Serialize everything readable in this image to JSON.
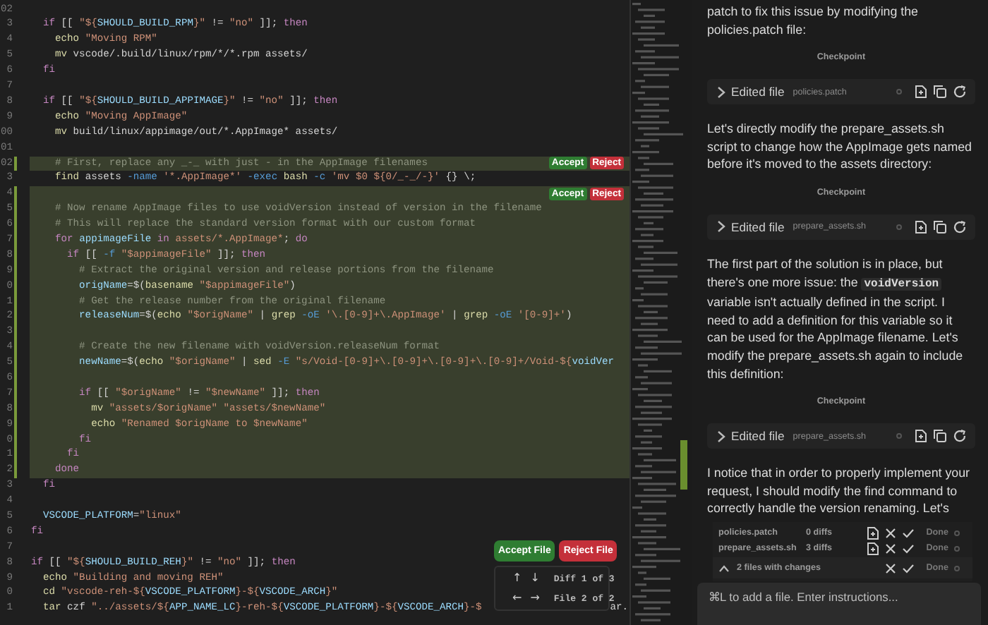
{
  "editor": {
    "lines": [
      {
        "number": "02",
        "added": false
      },
      {
        "number": "3",
        "added": false,
        "tokens": [
          {
            "kind": "kw",
            "text": "  if"
          },
          {
            "kind": "plain",
            "text": " [[ "
          },
          {
            "kind": "str",
            "text": "\"${"
          },
          {
            "kind": "var",
            "text": "SHOULD_BUILD_RPM"
          },
          {
            "kind": "str",
            "text": "}\""
          },
          {
            "kind": "plain",
            "text": " != "
          },
          {
            "kind": "str",
            "text": "\"no\""
          },
          {
            "kind": "plain",
            "text": " ]]; "
          },
          {
            "kind": "kw",
            "text": "then"
          }
        ]
      },
      {
        "number": "4",
        "added": false,
        "tokens": [
          {
            "kind": "cmd",
            "text": "    echo"
          },
          {
            "kind": "str",
            "text": " \"Moving RPM\""
          }
        ]
      },
      {
        "number": "5",
        "added": false,
        "tokens": [
          {
            "kind": "cmd",
            "text": "    mv"
          },
          {
            "kind": "plain",
            "text": " vscode/.build/linux/rpm/*/*.rpm assets/"
          }
        ]
      },
      {
        "number": "6",
        "added": false,
        "tokens": [
          {
            "kind": "kw",
            "text": "  fi"
          }
        ]
      },
      {
        "number": "7",
        "added": false
      },
      {
        "number": "8",
        "added": false,
        "tokens": [
          {
            "kind": "kw",
            "text": "  if"
          },
          {
            "kind": "plain",
            "text": " [[ "
          },
          {
            "kind": "str",
            "text": "\"${"
          },
          {
            "kind": "var",
            "text": "SHOULD_BUILD_APPIMAGE"
          },
          {
            "kind": "str",
            "text": "}\""
          },
          {
            "kind": "plain",
            "text": " != "
          },
          {
            "kind": "str",
            "text": "\"no\""
          },
          {
            "kind": "plain",
            "text": " ]]; "
          },
          {
            "kind": "kw",
            "text": "then"
          }
        ]
      },
      {
        "number": "9",
        "added": false,
        "tokens": [
          {
            "kind": "cmd",
            "text": "    echo"
          },
          {
            "kind": "str",
            "text": " \"Moving AppImage\""
          }
        ]
      },
      {
        "number": "00",
        "added": false,
        "tokens": [
          {
            "kind": "cmd",
            "text": "    mv"
          },
          {
            "kind": "plain",
            "text": " build/linux/appimage/out/*.AppImage* assets/"
          }
        ]
      },
      {
        "number": "01",
        "added": false
      },
      {
        "number": "02",
        "added": true,
        "tokens": [
          {
            "kind": "cmt",
            "text": "    # First, replace any _-_ with just - in the AppImage filenames"
          }
        ],
        "actions": [
          {
            "label": "Accept",
            "kind": "accept"
          },
          {
            "label": "Reject",
            "kind": "reject"
          }
        ]
      },
      {
        "number": "3",
        "added": false,
        "tokens": [
          {
            "kind": "cmd",
            "text": "    find"
          },
          {
            "kind": "plain",
            "text": " assets "
          },
          {
            "kind": "flag",
            "text": "-name"
          },
          {
            "kind": "str",
            "text": " '*.AppImage*'"
          },
          {
            "kind": "flag",
            "text": " -exec"
          },
          {
            "kind": "cmd",
            "text": " bash"
          },
          {
            "kind": "flag",
            "text": " -c"
          },
          {
            "kind": "str",
            "text": " 'mv $0 ${0/_-_/-}'"
          },
          {
            "kind": "plain",
            "text": " {} \\;"
          }
        ]
      },
      {
        "number": "4",
        "added": true,
        "actions": [
          {
            "label": "Accept",
            "kind": "accept"
          },
          {
            "label": "Reject",
            "kind": "reject"
          }
        ]
      },
      {
        "number": "5",
        "added": true,
        "tokens": [
          {
            "kind": "cmt",
            "text": "    # Now rename AppImage files to use voidVersion instead of version in the filename"
          }
        ]
      },
      {
        "number": "6",
        "added": true,
        "tokens": [
          {
            "kind": "cmt",
            "text": "    # This will replace the standard version format with our custom format"
          }
        ]
      },
      {
        "number": "7",
        "added": true,
        "tokens": [
          {
            "kind": "kw",
            "text": "    for"
          },
          {
            "kind": "var",
            "text": " appimageFile"
          },
          {
            "kind": "kw",
            "text": " in"
          },
          {
            "kind": "str",
            "text": " assets/*.AppImage*"
          },
          {
            "kind": "plain",
            "text": "; "
          },
          {
            "kind": "kw",
            "text": "do"
          }
        ]
      },
      {
        "number": "8",
        "added": true,
        "tokens": [
          {
            "kind": "kw",
            "text": "      if"
          },
          {
            "kind": "plain",
            "text": " [[ "
          },
          {
            "kind": "flag",
            "text": "-f"
          },
          {
            "kind": "str",
            "text": " \"$appimageFile\""
          },
          {
            "kind": "plain",
            "text": " ]]; "
          },
          {
            "kind": "kw",
            "text": "then"
          }
        ]
      },
      {
        "number": "9",
        "added": true,
        "tokens": [
          {
            "kind": "cmt",
            "text": "        # Extract the original version and release portions from the filename"
          }
        ]
      },
      {
        "number": "0",
        "added": true,
        "tokens": [
          {
            "kind": "var",
            "text": "        origName"
          },
          {
            "kind": "plain",
            "text": "=$("
          },
          {
            "kind": "cmd",
            "text": "basename"
          },
          {
            "kind": "str",
            "text": " \"$appimageFile\""
          },
          {
            "kind": "plain",
            "text": ")"
          }
        ]
      },
      {
        "number": "1",
        "added": true,
        "tokens": [
          {
            "kind": "cmt",
            "text": "        # Get the release number from the original filename"
          }
        ]
      },
      {
        "number": "2",
        "added": true,
        "tokens": [
          {
            "kind": "var",
            "text": "        releaseNum"
          },
          {
            "kind": "plain",
            "text": "=$("
          },
          {
            "kind": "cmd",
            "text": "echo"
          },
          {
            "kind": "str",
            "text": " \"$origName\""
          },
          {
            "kind": "plain",
            "text": " | "
          },
          {
            "kind": "cmd",
            "text": "grep"
          },
          {
            "kind": "flag",
            "text": " -oE"
          },
          {
            "kind": "str",
            "text": " '\\.[0-9]+\\.AppImage'"
          },
          {
            "kind": "plain",
            "text": " | "
          },
          {
            "kind": "cmd",
            "text": "grep"
          },
          {
            "kind": "flag",
            "text": " -oE"
          },
          {
            "kind": "str",
            "text": " '[0-9]+'"
          },
          {
            "kind": "plain",
            "text": ")"
          }
        ]
      },
      {
        "number": "3",
        "added": true
      },
      {
        "number": "4",
        "added": true,
        "tokens": [
          {
            "kind": "cmt",
            "text": "        # Create the new filename with voidVersion.releaseNum format"
          }
        ]
      },
      {
        "number": "5",
        "added": true,
        "tokens": [
          {
            "kind": "var",
            "text": "        newName"
          },
          {
            "kind": "plain",
            "text": "=$("
          },
          {
            "kind": "cmd",
            "text": "echo"
          },
          {
            "kind": "str",
            "text": " \"$origName\""
          },
          {
            "kind": "plain",
            "text": " | "
          },
          {
            "kind": "cmd",
            "text": "sed"
          },
          {
            "kind": "flag",
            "text": " -E"
          },
          {
            "kind": "str",
            "text": " \"s/Void-[0-9]+\\.[0-9]+\\.[0-9]+\\.[0-9]+/Void-${"
          },
          {
            "kind": "var",
            "text": "voidVer"
          }
        ]
      },
      {
        "number": "6",
        "added": true
      },
      {
        "number": "7",
        "added": true,
        "tokens": [
          {
            "kind": "kw",
            "text": "        if"
          },
          {
            "kind": "plain",
            "text": " [[ "
          },
          {
            "kind": "str",
            "text": "\"$origName\""
          },
          {
            "kind": "plain",
            "text": " != "
          },
          {
            "kind": "str",
            "text": "\"$newName\""
          },
          {
            "kind": "plain",
            "text": " ]]; "
          },
          {
            "kind": "kw",
            "text": "then"
          }
        ]
      },
      {
        "number": "8",
        "added": true,
        "tokens": [
          {
            "kind": "cmd",
            "text": "          mv"
          },
          {
            "kind": "str",
            "text": " \"assets/$origName\" \"assets/$newName\""
          }
        ]
      },
      {
        "number": "9",
        "added": true,
        "tokens": [
          {
            "kind": "cmd",
            "text": "          echo"
          },
          {
            "kind": "str",
            "text": " \"Renamed $origName to $newName\""
          }
        ]
      },
      {
        "number": "0",
        "added": true,
        "tokens": [
          {
            "kind": "kw",
            "text": "        fi"
          }
        ]
      },
      {
        "number": "1",
        "added": true,
        "tokens": [
          {
            "kind": "kw",
            "text": "      fi"
          }
        ]
      },
      {
        "number": "2",
        "added": true,
        "tokens": [
          {
            "kind": "kw",
            "text": "    done"
          }
        ]
      },
      {
        "number": "3",
        "added": false,
        "tokens": [
          {
            "kind": "kw",
            "text": "  fi"
          }
        ]
      },
      {
        "number": "4",
        "added": false
      },
      {
        "number": "5",
        "added": false,
        "tokens": [
          {
            "kind": "var",
            "text": "  VSCODE_PLATFORM"
          },
          {
            "kind": "plain",
            "text": "="
          },
          {
            "kind": "str",
            "text": "\"linux\""
          }
        ]
      },
      {
        "number": "6",
        "added": false,
        "tokens": [
          {
            "kind": "kw",
            "text": "fi"
          }
        ]
      },
      {
        "number": "7",
        "added": false
      },
      {
        "number": "8",
        "added": false,
        "tokens": [
          {
            "kind": "kw",
            "text": "if"
          },
          {
            "kind": "plain",
            "text": " [[ "
          },
          {
            "kind": "str",
            "text": "\"${"
          },
          {
            "kind": "var",
            "text": "SHOULD_BUILD_REH"
          },
          {
            "kind": "str",
            "text": "}\""
          },
          {
            "kind": "plain",
            "text": " != "
          },
          {
            "kind": "str",
            "text": "\"no\""
          },
          {
            "kind": "plain",
            "text": " ]]; "
          },
          {
            "kind": "kw",
            "text": "then"
          }
        ]
      },
      {
        "number": "9",
        "added": false,
        "tokens": [
          {
            "kind": "cmd",
            "text": "  echo"
          },
          {
            "kind": "str",
            "text": " \"Building and moving REH\""
          }
        ]
      },
      {
        "number": "0",
        "added": false,
        "tokens": [
          {
            "kind": "cmd",
            "text": "  cd"
          },
          {
            "kind": "str",
            "text": " \"vscode-reh-${"
          },
          {
            "kind": "var",
            "text": "VSCODE_PLATFORM"
          },
          {
            "kind": "str",
            "text": "}-${"
          },
          {
            "kind": "var",
            "text": "VSCODE_ARCH"
          },
          {
            "kind": "str",
            "text": "}\""
          }
        ]
      },
      {
        "number": "1",
        "added": false,
        "tokens": [
          {
            "kind": "cmd",
            "text": "  tar"
          },
          {
            "kind": "plain",
            "text": " czf "
          },
          {
            "kind": "str",
            "text": "\"../assets/${"
          },
          {
            "kind": "var",
            "text": "APP_NAME_LC"
          },
          {
            "kind": "str",
            "text": "}-reh-${"
          },
          {
            "kind": "var",
            "text": "VSCODE_PLATFORM"
          },
          {
            "kind": "str",
            "text": "}-${"
          },
          {
            "kind": "var",
            "text": "VSCODE_ARCH"
          },
          {
            "kind": "str",
            "text": "}-$"
          }
        ],
        "tail": "ar."
      }
    ],
    "file_actions": [
      {
        "label": "Accept File",
        "kind": "accept"
      },
      {
        "label": "Reject File",
        "kind": "reject"
      }
    ],
    "navigation": [
      {
        "arrows": [
          "↑",
          "↓"
        ],
        "label": "Diff 1 of 3"
      },
      {
        "arrows": [
          "←",
          "→"
        ],
        "label": "File 2 of 2"
      }
    ]
  },
  "chat": {
    "messages": [
      {
        "kind": "text",
        "parts": [
          {
            "kind": "text",
            "text": "patch to fix this issue by modifying the policies.patch file:"
          }
        ]
      },
      {
        "kind": "checkpoint",
        "text": "Checkpoint"
      },
      {
        "kind": "edit",
        "title": "Edited file",
        "file": "policies.patch"
      },
      {
        "kind": "text",
        "parts": [
          {
            "kind": "text",
            "text": "Let's directly modify the prepare_assets.sh script to change how the AppImage gets named before it's moved to the assets directory:"
          }
        ]
      },
      {
        "kind": "checkpoint",
        "text": "Checkpoint"
      },
      {
        "kind": "edit",
        "title": "Edited file",
        "file": "prepare_assets.sh"
      },
      {
        "kind": "text",
        "parts": [
          {
            "kind": "text",
            "text": "The first part of the solution is in place, but there's one more issue: the "
          },
          {
            "kind": "code",
            "text": "voidVersion"
          },
          {
            "kind": "text",
            "text": " variable isn't actually defined in the script. I need to add a definition for this variable so it can be used for the AppImage filename. Let's modify the prepare_assets.sh again to include this definition:"
          }
        ]
      },
      {
        "kind": "checkpoint",
        "text": "Checkpoint"
      },
      {
        "kind": "edit",
        "title": "Edited file",
        "file": "prepare_assets.sh"
      },
      {
        "kind": "text",
        "parts": [
          {
            "kind": "text",
            "text": "I notice that in order to properly implement your request, I should modify the find command to correctly handle the version renaming. Let's"
          }
        ]
      }
    ],
    "changes": {
      "files": [
        {
          "name": "policies.patch",
          "diffs": "0 diffs",
          "status": "Done"
        },
        {
          "name": "prepare_assets.sh",
          "diffs": "3 diffs",
          "status": "Done"
        }
      ],
      "summary": "2 files with changes",
      "status": "Done"
    },
    "input": {
      "placeholder": "⌘L to add a file. Enter instructions..."
    }
  }
}
